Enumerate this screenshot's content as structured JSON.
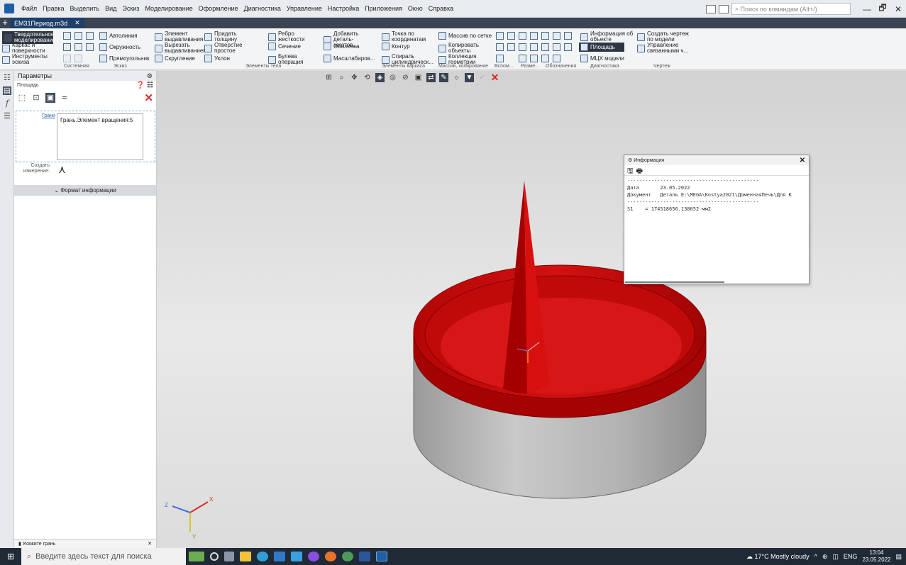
{
  "menubar": {
    "items": [
      "Файл",
      "Правка",
      "Выделить",
      "Вид",
      "Эскиз",
      "Моделирование",
      "Оформление",
      "Диагностика",
      "Управление",
      "Настройка",
      "Приложения",
      "Окно",
      "Справка"
    ],
    "search_placeholder": "Поиск по командам (Alt+/)",
    "minimize": "—",
    "maximize": "🗗",
    "close": "✕"
  },
  "tabs": {
    "add": "+",
    "doc_title": "ЕМ31Период.m3d",
    "doc_close": "✕"
  },
  "ribbon": {
    "modes": [
      "Твердотельное моделирование",
      "Каркас и поверхности",
      "Инструменты эскиза"
    ],
    "sketch": [
      "Автолиния",
      "Окружность",
      "Прямоугольник"
    ],
    "body": [
      "Элемент выдавливания",
      "Вырезать выдавливанием",
      "Скругление",
      "Придать толщину",
      "Отверстие простое",
      "Уклон",
      "Ребро жесткости",
      "Сечение",
      "Булева операция",
      "Добавить деталь-заготов...",
      "Оболочка",
      "Масштабиров..."
    ],
    "wire": [
      "Точка по координатам",
      "Контур",
      "Спираль цилиндрическ..."
    ],
    "array": [
      "Массив по сетке",
      "Копировать объекты",
      "Коллекция геометрии"
    ],
    "diag": [
      "Информация об объекте",
      "Площадь",
      "МЦХ модели"
    ],
    "drawing": [
      "Создать чертеж по модели",
      "Управление связанными ч..."
    ],
    "groups": [
      "Системная",
      "Эскиз",
      "Элементы тела",
      "Элементы каркаса",
      "Массив, копирование",
      "Вспом...",
      "Разме...",
      "Обозначения",
      "Диагностика",
      "Чертеж"
    ]
  },
  "params": {
    "title": "Параметры",
    "subtitle": "Площадь",
    "faces_label": "Грани",
    "faces_value": "Грань.Элемент вращения:5",
    "create_measure": "Создать измерение:",
    "format_info": "Формат информации",
    "hint": "Укажите грань",
    "hint_close": "✕"
  },
  "info_window": {
    "title": "Информация",
    "close": "✕",
    "separator": "--------------------------------------------",
    "date_label": "Дата",
    "date_value": "23.05.2022",
    "doc_label": "Документ",
    "doc_value": "Деталь E:\\MEGA\\Kostya2021\\ДоменнаяПечь\\Для К",
    "s1_label": "S1",
    "s1_value": "= 174518656.138052 мм2"
  },
  "taskbar": {
    "search_placeholder": "Введите здесь текст для поиска",
    "weather": "17°C  Mostly cloudy",
    "lang": "ENG",
    "time": "13:04",
    "date": "23.05.2022"
  },
  "colors": {
    "face_highlight": "#b00000",
    "body_gray": "#a8a8a8",
    "accent": "#1f5fa8"
  }
}
